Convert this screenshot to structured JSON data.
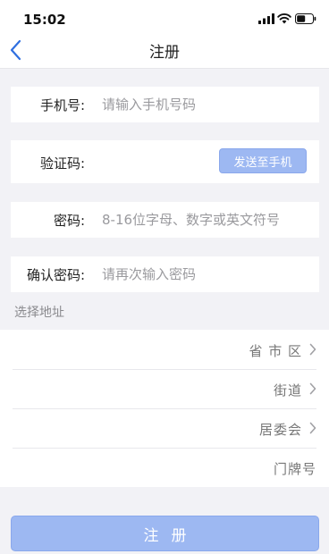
{
  "status_bar": {
    "time": "15:02"
  },
  "nav": {
    "title": "注册",
    "back_icon": "chevron-left-icon"
  },
  "form": {
    "phone": {
      "label": "手机号:",
      "placeholder": "请输入手机号码",
      "value": ""
    },
    "code": {
      "label": "验证码:",
      "value": "",
      "send_button": "发送至手机"
    },
    "password": {
      "label": "密码:",
      "placeholder": "8-16位字母、数字或英文符号",
      "value": ""
    },
    "confirm": {
      "label": "确认密码:",
      "placeholder": "请再次输入密码",
      "value": ""
    }
  },
  "address": {
    "section_title": "选择地址",
    "items": [
      {
        "label": "省 市 区"
      },
      {
        "label": "街道"
      },
      {
        "label": "居委会"
      },
      {
        "label": "门牌号"
      }
    ]
  },
  "register_button": "注册",
  "colors": {
    "accent": "#9db8f2",
    "back_icon": "#2f6fe0",
    "background": "#f2f2f6"
  }
}
